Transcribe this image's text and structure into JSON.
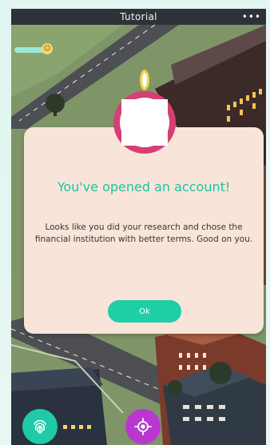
{
  "titlebar": {
    "title": "Tutorial",
    "menu": "•••"
  },
  "hud": {
    "progress_fraction": 0.8,
    "mood": "☺"
  },
  "modal": {
    "title": "You've opened an account!",
    "body": "Looks like you did your research and chose the financial institution with better terms. Good on you.",
    "ok_label": "Ok"
  },
  "icons": {
    "fingerprint": "fingerprint-icon",
    "locate": "crosshair-icon",
    "menu": "more-icon"
  },
  "colors": {
    "accent_teal": "#1ecea7",
    "accent_pink": "#d63f76",
    "accent_purple": "#ba37cf",
    "modal_bg": "#f8e4d9",
    "title_bar": "#2e3238"
  }
}
